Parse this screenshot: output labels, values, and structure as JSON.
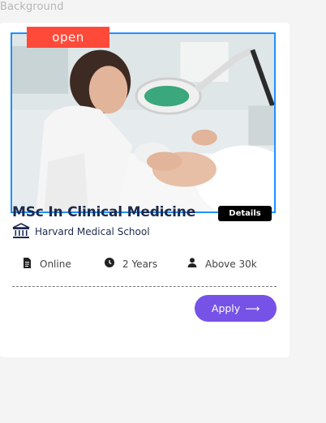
{
  "canvas": {
    "label": "Background"
  },
  "course_card": {
    "status_badge": "open",
    "title": "MSc In Clinical Medicine",
    "details_label": "Details",
    "school": "Harvard Medical School",
    "meta": {
      "mode": "Online",
      "duration": "2 Years",
      "students": "Above 30k"
    },
    "apply_label": "Apply",
    "apply_arrow": "⟶",
    "image_alt": "Clinician examining patient with magnifying lamp"
  },
  "colors": {
    "accent_purple": "#7752e6",
    "badge_red": "#ff4a3a",
    "title_navy": "#1d2a4d",
    "selection_blue": "#1e90ff"
  },
  "icons": [
    "bank-icon",
    "document-icon",
    "clock-icon",
    "person-icon",
    "arrow-right-icon"
  ]
}
